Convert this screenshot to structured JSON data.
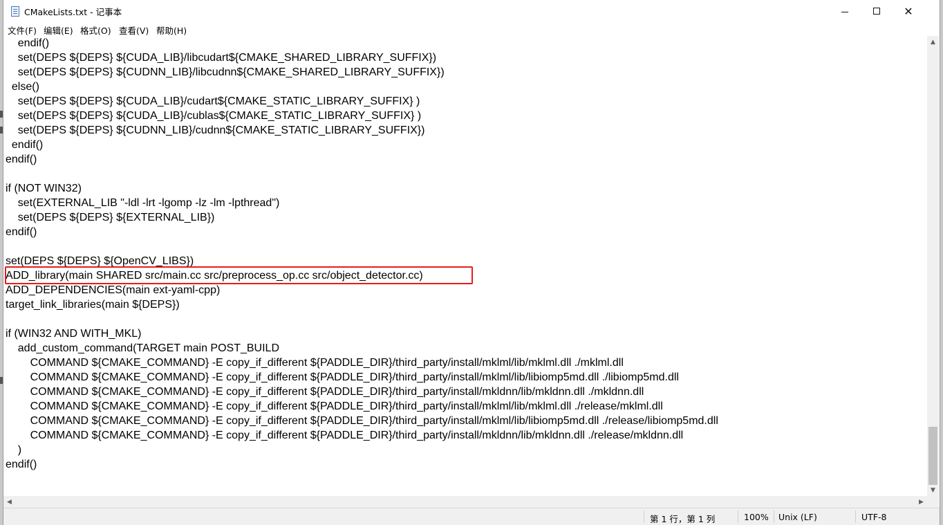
{
  "window": {
    "title": "CMakeLists.txt - 记事本"
  },
  "menu": [
    "文件(F)",
    "编辑(E)",
    "格式(O)",
    "查看(V)",
    "帮助(H)"
  ],
  "editor": {
    "lines": [
      "    endif()",
      "    set(DEPS ${DEPS} ${CUDA_LIB}/libcudart${CMAKE_SHARED_LIBRARY_SUFFIX})",
      "    set(DEPS ${DEPS} ${CUDNN_LIB}/libcudnn${CMAKE_SHARED_LIBRARY_SUFFIX})",
      "  else()",
      "    set(DEPS ${DEPS} ${CUDA_LIB}/cudart${CMAKE_STATIC_LIBRARY_SUFFIX} )",
      "    set(DEPS ${DEPS} ${CUDA_LIB}/cublas${CMAKE_STATIC_LIBRARY_SUFFIX} )",
      "    set(DEPS ${DEPS} ${CUDNN_LIB}/cudnn${CMAKE_STATIC_LIBRARY_SUFFIX})",
      "  endif()",
      "endif()",
      "",
      "if (NOT WIN32)",
      "    set(EXTERNAL_LIB \"-ldl -lrt -lgomp -lz -lm -lpthread\")",
      "    set(DEPS ${DEPS} ${EXTERNAL_LIB})",
      "endif()",
      "",
      "set(DEPS ${DEPS} ${OpenCV_LIBS})",
      "ADD_library(main SHARED src/main.cc src/preprocess_op.cc src/object_detector.cc)",
      "ADD_DEPENDENCIES(main ext-yaml-cpp)",
      "target_link_libraries(main ${DEPS})",
      "",
      "if (WIN32 AND WITH_MKL)",
      "    add_custom_command(TARGET main POST_BUILD",
      "        COMMAND ${CMAKE_COMMAND} -E copy_if_different ${PADDLE_DIR}/third_party/install/mklml/lib/mklml.dll ./mklml.dll",
      "        COMMAND ${CMAKE_COMMAND} -E copy_if_different ${PADDLE_DIR}/third_party/install/mklml/lib/libiomp5md.dll ./libiomp5md.dll",
      "        COMMAND ${CMAKE_COMMAND} -E copy_if_different ${PADDLE_DIR}/third_party/install/mkldnn/lib/mkldnn.dll ./mkldnn.dll",
      "        COMMAND ${CMAKE_COMMAND} -E copy_if_different ${PADDLE_DIR}/third_party/install/mklml/lib/mklml.dll ./release/mklml.dll",
      "        COMMAND ${CMAKE_COMMAND} -E copy_if_different ${PADDLE_DIR}/third_party/install/mklml/lib/libiomp5md.dll ./release/libiomp5md.dll",
      "        COMMAND ${CMAKE_COMMAND} -E copy_if_different ${PADDLE_DIR}/third_party/install/mkldnn/lib/mkldnn.dll ./release/mkldnn.dll",
      "    )",
      "endif()"
    ],
    "highlighted_line": 16,
    "highlight_color": "#e51c1c"
  },
  "status": {
    "position": "第 1 行，第 1 列",
    "zoom": "100%",
    "line_ending": "Unix (LF)",
    "encoding": "UTF-8"
  }
}
